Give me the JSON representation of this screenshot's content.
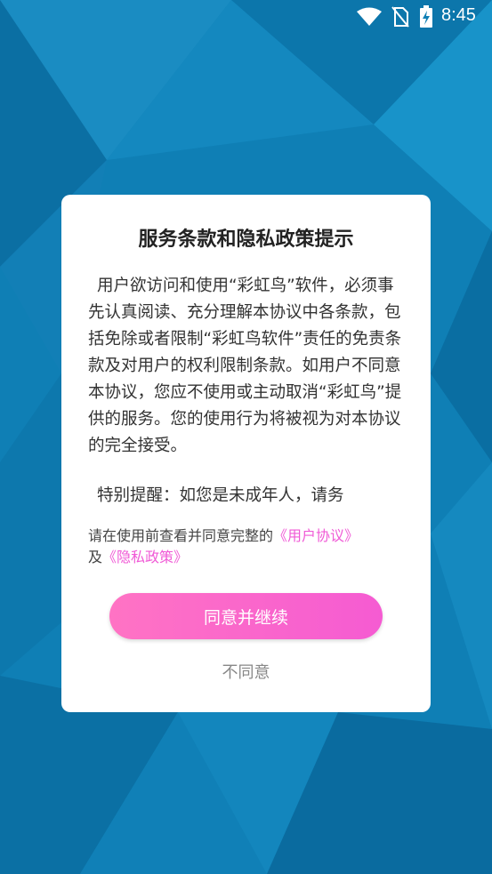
{
  "status_bar": {
    "time": "8:45",
    "icons": [
      "wifi-icon",
      "no-sim-icon",
      "battery-charging-icon"
    ]
  },
  "dialog": {
    "title": "服务条款和隐私政策提示",
    "body_paragraphs": [
      "用户欲访问和使用“彩虹鸟”软件，必须事先认真阅读、充分理解本协议中各条款，包括免除或者限制“彩虹鸟软件”责任的免责条款及对用户的权利限制条款。如用户不同意本协议，您应不使用或主动取消“彩虹鸟”提供的服务。您的使用行为将被视为对本协议的完全接受。",
      "特别提醒：如您是未成年人，请务"
    ],
    "note_prefix": "请在使用前查看并同意完整的",
    "user_agreement_link": "《用户协议》",
    "note_and": "及",
    "privacy_policy_link": "《隐私政策》",
    "agree_label": "同意并继续",
    "disagree_label": "不同意"
  },
  "colors": {
    "background": "#0f7fb5",
    "link": "#f05ad6",
    "button_gradient_start": "#ff73c4",
    "button_gradient_end": "#f55bd2"
  }
}
